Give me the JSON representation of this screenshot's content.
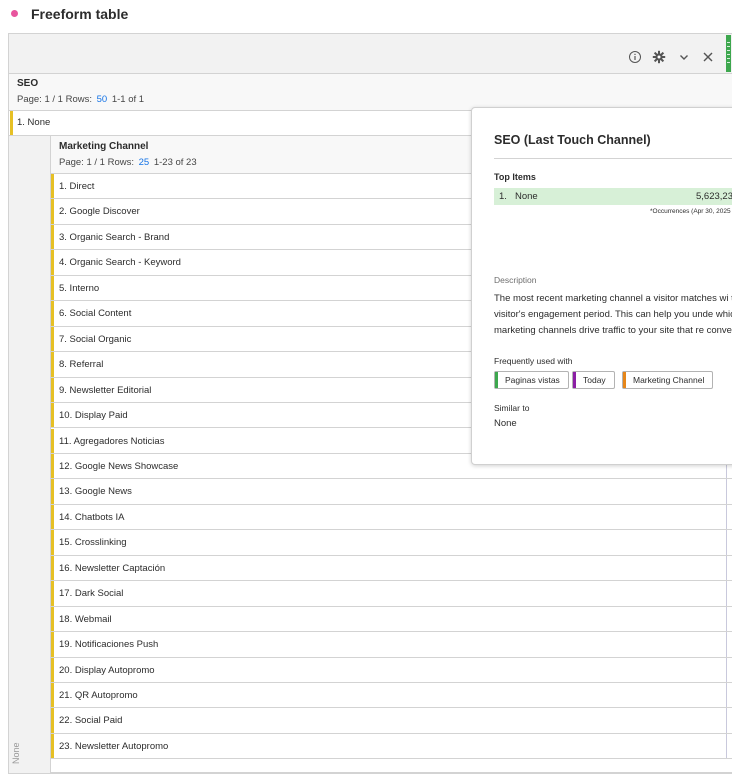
{
  "page": {
    "title": "Freeform table"
  },
  "colors": {
    "accent_link": "#1473e6",
    "row_marker": "#e6c025",
    "top_item_bg": "#d7f0d7",
    "dot": "#e8559e",
    "header_metric": "#3da74e"
  },
  "seo": {
    "title": "SEO",
    "pager_prefix": "Page: 1 / 1 Rows:",
    "rows_value": "50",
    "range": "1-1 of 1",
    "icons": [
      "info-icon",
      "gear-icon",
      "chevron-down-icon",
      "close-icon"
    ],
    "none_row": "1.  None"
  },
  "marketing_channel": {
    "title": "Marketing Channel",
    "pager_prefix": "Page: 1 / 1 Rows:",
    "rows_value": "25",
    "range": "1-23 of 23",
    "rows": [
      "1.  Direct",
      "2.  Google Discover",
      "3.  Organic Search - Brand",
      "4.  Organic Search - Keyword",
      "5.  Interno",
      "6.  Social Content",
      "7.  Social Organic",
      "8.  Referral",
      "9.  Newsletter Editorial",
      "10.  Display Paid",
      "11.  Agregadores Noticias",
      "12.  Google News Showcase",
      "13.  Google News",
      "14.  Chatbots IA",
      "15.  Crosslinking",
      "16.  Newsletter Captación",
      "17.  Dark Social",
      "18.  Webmail",
      "19.  Notificaciones Push",
      "20.  Display Autopromo",
      "21.  QR Autopromo",
      "22.  Social Paid",
      "23.  Newsletter Autopromo"
    ],
    "gutter_label": "None"
  },
  "popover": {
    "title": "SEO (Last Touch Channel)",
    "top_items_label": "Top Items",
    "top_item": {
      "rank": "1.",
      "name": "None",
      "value": "5,623,23"
    },
    "occurrences_note": "*Occurrences (Apr 30, 2025",
    "description_label": "Description",
    "description": "The most recent marketing channel a visitor matches wi that visitor's engagement period. This can help you unde which marketing channels drive traffic to your site that re conversions.",
    "frequently_used_label": "Frequently used with",
    "chips": [
      {
        "label": "Paginas vistas",
        "color": "#3da74e"
      },
      {
        "label": "Today",
        "color": "#8c1fa5"
      },
      {
        "label": "Marketing Channel",
        "color": "#e68619"
      }
    ],
    "similar_label": "Similar to",
    "similar_value": "None"
  }
}
